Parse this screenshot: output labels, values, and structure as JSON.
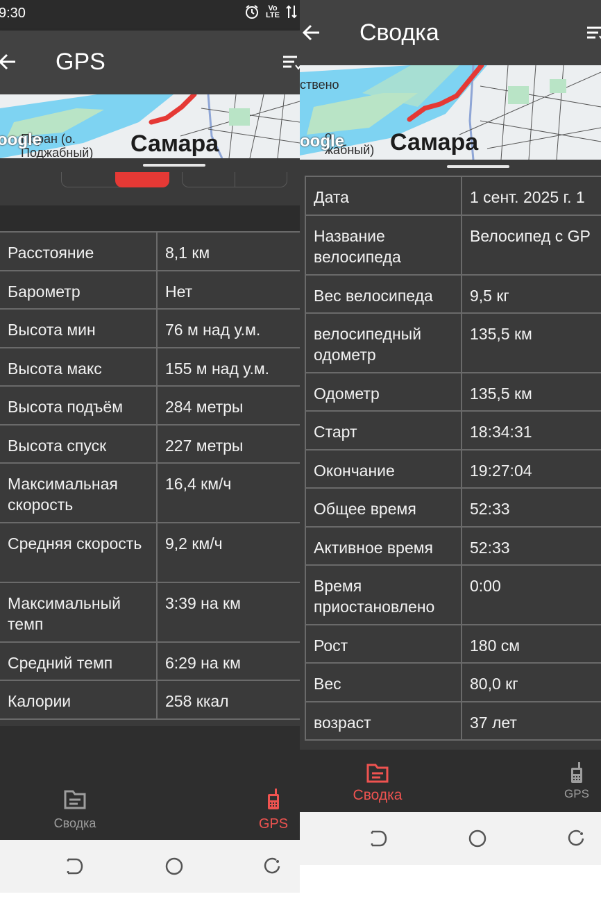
{
  "left": {
    "status_bar": {
      "time": "9:30",
      "alarm_icon": "alarm-icon",
      "volte_label": "Vo LTE",
      "data_icon": "data-arrows-icon"
    },
    "app_bar": {
      "title": "GPS",
      "back_icon": "arrow-back-icon",
      "menu_icon": "sort-menu-icon"
    },
    "map": {
      "city": "Самара",
      "place_label": "Поран (о.\nПоджабный)",
      "google_label": "oogle"
    },
    "stats": [
      {
        "label": "Расстояние",
        "value": "8,1 км"
      },
      {
        "label": "Барометр",
        "value": "Нет"
      },
      {
        "label": "Высота мин",
        "value": "76 м над у.м."
      },
      {
        "label": "Высота макс",
        "value": "155 м над у.м."
      },
      {
        "label": "Высота подъём",
        "value": "284 метры"
      },
      {
        "label": "Высота спуск",
        "value": "227 метры"
      },
      {
        "label": "Максимальная скорость",
        "value": "16,4 км/ч"
      },
      {
        "label": "Средняя скорость",
        "value": "9,2 км/ч"
      },
      {
        "label": "Максимальный темп",
        "value": "3:39 на км"
      },
      {
        "label": "Средний темп",
        "value": "6:29 на км"
      },
      {
        "label": "Калории",
        "value": "258 ккал"
      }
    ],
    "bottom_nav": [
      {
        "label": "Сводка",
        "icon": "summary-folder-icon",
        "active": false
      },
      {
        "label": "GPS",
        "icon": "gps-phone-icon",
        "active": true
      }
    ]
  },
  "right": {
    "app_bar": {
      "title": "Сводка",
      "back_icon": "arrow-back-icon",
      "menu_icon": "sort-menu-icon"
    },
    "map": {
      "city": "Самара",
      "top_label": "ствено",
      "place_label": "о.\nжабный)",
      "google_label": "oogle"
    },
    "stats": [
      {
        "label": "Дата",
        "value": "1 сент. 2025 г. 1"
      },
      {
        "label": "Название велосипеда",
        "value": "Велосипед с GP"
      },
      {
        "label": "Вес велосипеда",
        "value": "9,5 кг"
      },
      {
        "label": "велосипедный одометр",
        "value": "135,5 км"
      },
      {
        "label": "Одометр",
        "value": "135,5 км"
      },
      {
        "label": "Старт",
        "value": "18:34:31"
      },
      {
        "label": "Окончание",
        "value": "19:27:04"
      },
      {
        "label": "Общее время",
        "value": "52:33"
      },
      {
        "label": "Активное время",
        "value": "52:33"
      },
      {
        "label": "Время приостановлено",
        "value": "0:00"
      },
      {
        "label": "Рост",
        "value": "180 см"
      },
      {
        "label": "Вес",
        "value": "80,0 кг"
      },
      {
        "label": "возраст",
        "value": "37 лет"
      }
    ],
    "bottom_nav": [
      {
        "label": "Сводка",
        "icon": "summary-folder-icon",
        "active": true
      },
      {
        "label": "GPS",
        "icon": "gps-phone-icon",
        "active": false
      }
    ]
  },
  "colors": {
    "accent": "#ef5350",
    "bg": "#3a3a3a",
    "appbar": "#424242",
    "route": "#e53935",
    "water": "#7ed3f2"
  }
}
